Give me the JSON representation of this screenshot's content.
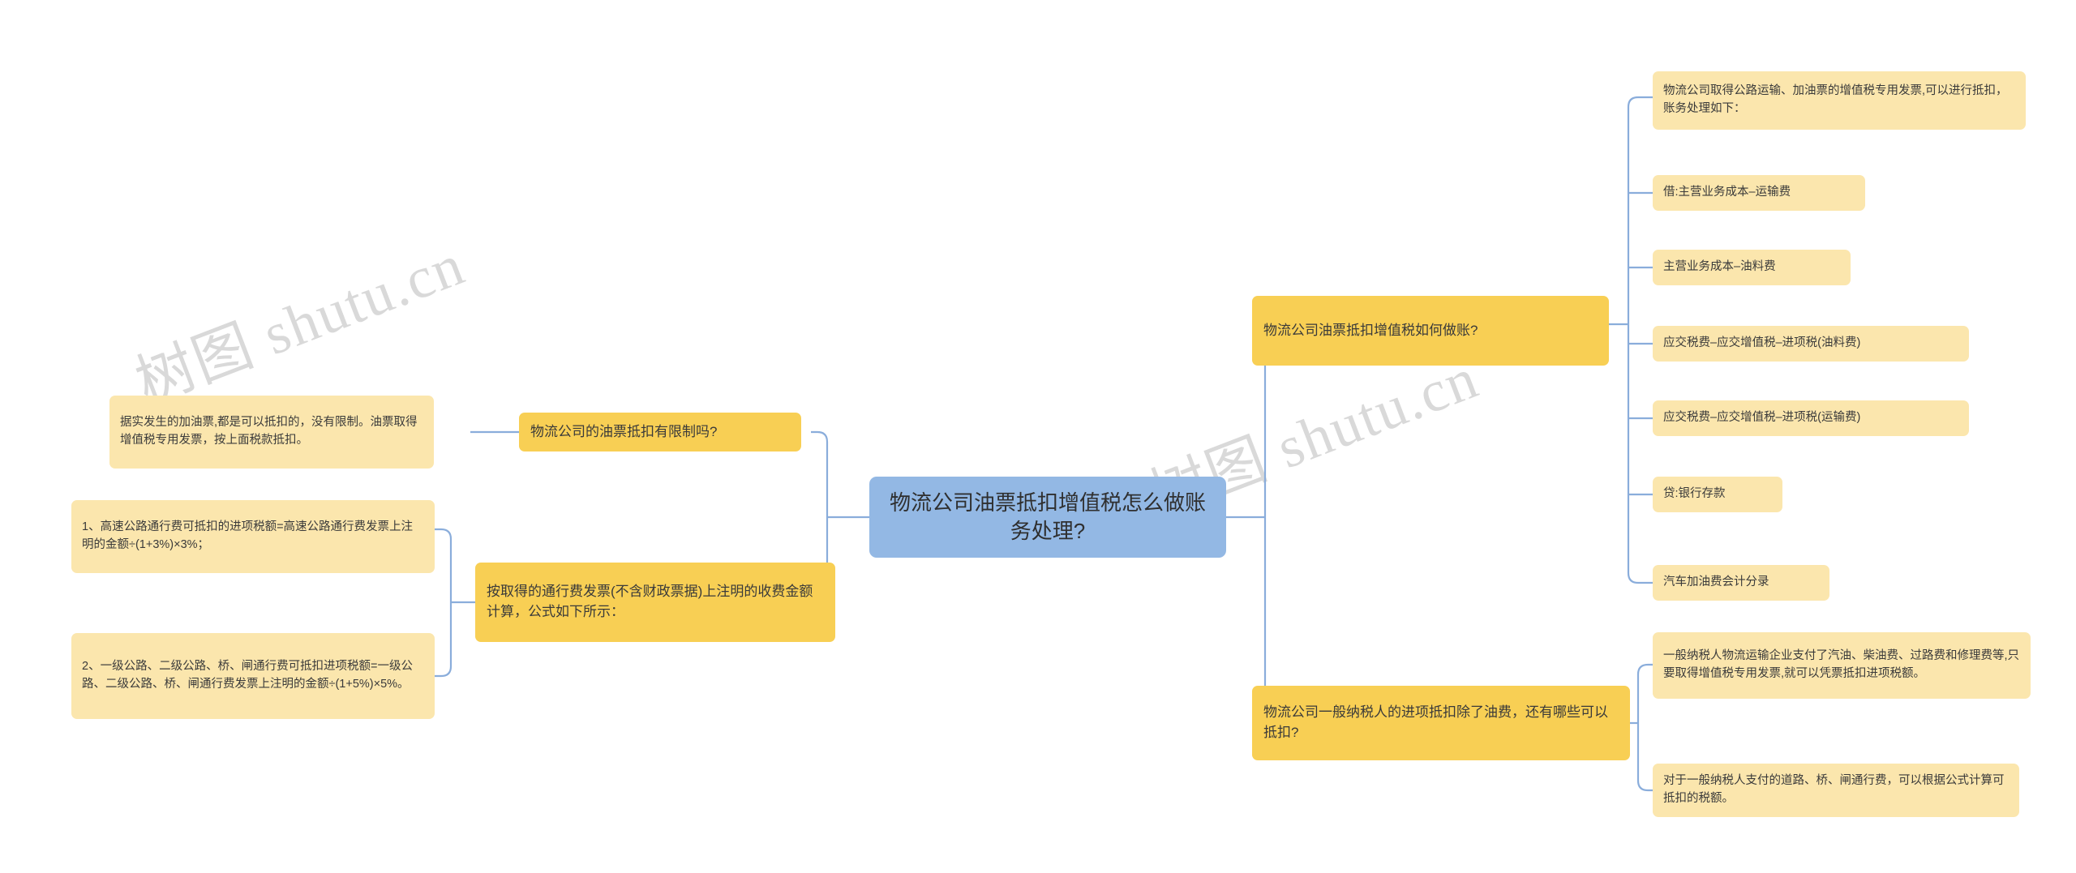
{
  "document": {
    "type": "mindmap",
    "title": "物流公司油票抵扣增值税怎么做账务处理?",
    "watermark_text": "树图 shutu.cn",
    "colors": {
      "root_fill": "#93b8e4",
      "branch_fill": "#f8cf54",
      "leaf_fill": "#fbe6ad",
      "connector": "#8aaddb",
      "text": "#3a3a3a",
      "background": "#ffffff",
      "watermark": "#d9d9d9"
    }
  },
  "root": {
    "label": "物流公司油票抵扣增值税怎么做账务处理?"
  },
  "left_branches": [
    {
      "label": "物流公司的油票抵扣有限制吗?",
      "children": [
        {
          "label": "据实发生的加油票,都是可以抵扣的，没有限制。油票取得增值税专用发票，按上面税款抵扣。"
        }
      ]
    },
    {
      "label": "按取得的通行费发票(不含财政票据)上注明的收费金额计算，公式如下所示：",
      "children": [
        {
          "label": "1、高速公路通行费可抵扣的进项税额=高速公路通行费发票上注明的金额÷(1+3%)×3%；"
        },
        {
          "label": "2、一级公路、二级公路、桥、闸通行费可抵扣进项税额=一级公路、二级公路、桥、闸通行费发票上注明的金额÷(1+5%)×5%。"
        }
      ]
    }
  ],
  "right_branches": [
    {
      "label": "物流公司油票抵扣增值税如何做账?",
      "children": [
        {
          "label": "物流公司取得公路运输、加油票的增值税专用发票,可以进行抵扣，账务处理如下："
        },
        {
          "label": "借:主营业务成本–运输费"
        },
        {
          "label": "主营业务成本–油料费"
        },
        {
          "label": "应交税费–应交增值税–进项税(油料费)"
        },
        {
          "label": "应交税费–应交增值税–进项税(运输费)"
        },
        {
          "label": "贷:银行存款"
        },
        {
          "label": "汽车加油费会计分录"
        }
      ]
    },
    {
      "label": "物流公司一般纳税人的进项抵扣除了油费，还有哪些可以抵扣?",
      "children": [
        {
          "label": "一般纳税人物流运输企业支付了汽油、柴油费、过路费和修理费等,只要取得增值税专用发票,就可以凭票抵扣进项税额。"
        },
        {
          "label": "对于一般纳税人支付的道路、桥、闸通行费，可以根据公式计算可抵扣的税额。"
        }
      ]
    }
  ]
}
